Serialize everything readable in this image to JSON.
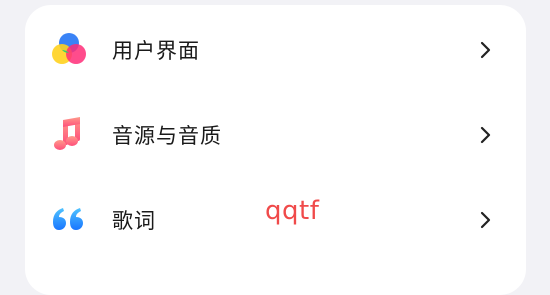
{
  "menu": {
    "items": [
      {
        "label": "用户界面",
        "icon": "color-palette-icon"
      },
      {
        "label": "音源与音质",
        "icon": "music-note-icon"
      },
      {
        "label": "歌词",
        "icon": "quote-icon"
      }
    ]
  },
  "overlay": {
    "text": "qqtf"
  },
  "colors": {
    "background": "#f2f2f6",
    "card": "#ffffff",
    "text": "#1a1a1a",
    "chevron": "#222222",
    "music_gradient_top": "#ff9a8b",
    "music_gradient_bottom": "#ff4f7b",
    "quote_gradient_top": "#4fc3ff",
    "quote_gradient_bottom": "#1976ff",
    "watermark": "#f04a4a"
  }
}
